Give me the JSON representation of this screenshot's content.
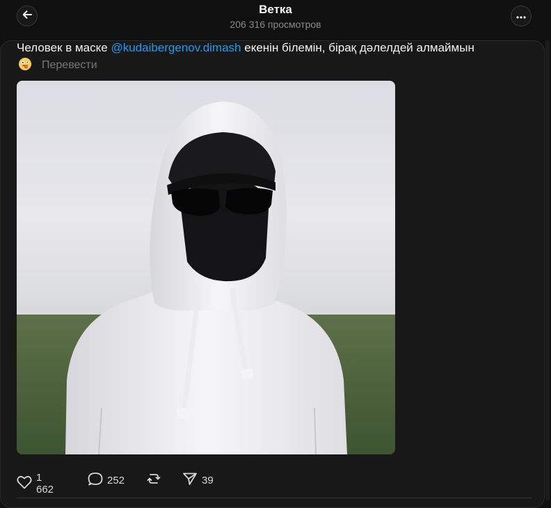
{
  "header": {
    "title": "Ветка",
    "views": "206 316 просмотров"
  },
  "post": {
    "text_before": "Человек в маске ",
    "mention": "@kudaibergenov.dimash",
    "text_after": " екенін білемін, бірақ дәлелдей алмаймын",
    "translate_label": "Перевести",
    "emoji": "face-with-tongue-emoji"
  },
  "actions": {
    "likes": "1 662",
    "replies": "252",
    "shares": "39"
  },
  "icons": [
    "back-arrow-icon",
    "more-icon",
    "heart-icon",
    "comment-icon",
    "repost-icon",
    "share-icon"
  ]
}
